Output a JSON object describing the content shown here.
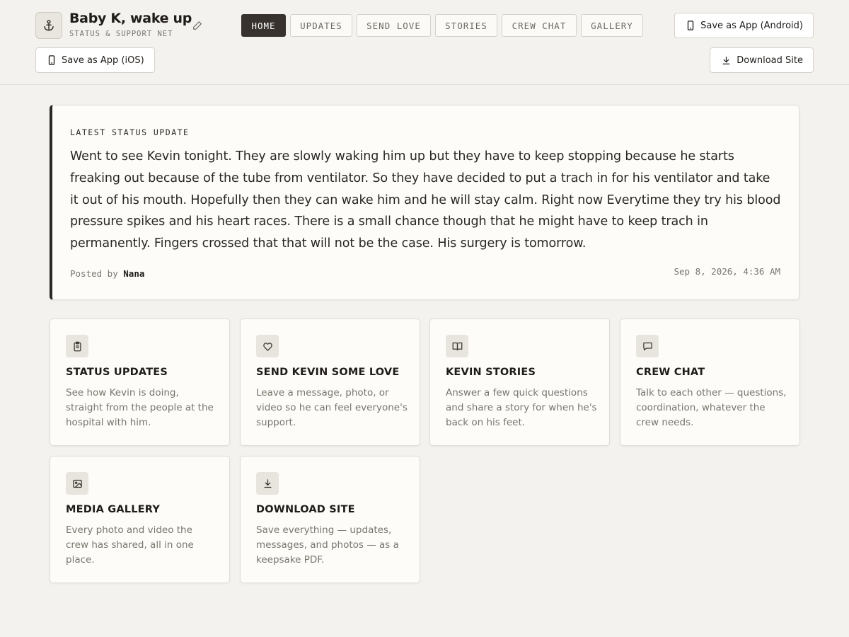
{
  "site": {
    "title": "Baby K, wake up",
    "subtitle": "STATUS & SUPPORT NET",
    "logo_icon": "anchor-icon",
    "edit_icon": "pencil-icon"
  },
  "nav": {
    "tabs": [
      {
        "label": "HOME",
        "active": true
      },
      {
        "label": "UPDATES",
        "active": false
      },
      {
        "label": "SEND LOVE",
        "active": false
      },
      {
        "label": "STORIES",
        "active": false
      },
      {
        "label": "CREW CHAT",
        "active": false
      },
      {
        "label": "GALLERY",
        "active": false
      }
    ]
  },
  "actions": {
    "android_label": "Save as App (Android)",
    "ios_label": "Save as App (iOS)",
    "download_label": "Download Site"
  },
  "status": {
    "label": "LATEST STATUS UPDATE",
    "body": "Went to see Kevin tonight. They are slowly waking him up but they have to keep stopping because he starts freaking out because of the tube from ventilator. So they have decided to put a trach in for his ventilator and take it out of his mouth. Hopefully then they can wake him and he will stay calm. Right now Everytime they try his blood pressure spikes and his heart races. There is a small chance though that he might have to keep trach in permanently. Fingers crossed that that will not be the case. His surgery is tomorrow.",
    "posted_prefix": "Posted by",
    "author": "Nana",
    "timestamp": "Sep 8, 2026, 4:36 AM"
  },
  "cards": [
    {
      "icon": "clipboard-icon",
      "title": "STATUS UPDATES",
      "desc": "See how Kevin is doing, straight from the people at the hospital with him."
    },
    {
      "icon": "heart-icon",
      "title": "SEND KEVIN SOME LOVE",
      "desc": "Leave a message, photo, or video so he can feel everyone's support."
    },
    {
      "icon": "book-icon",
      "title": "KEVIN STORIES",
      "desc": "Answer a few quick questions and share a story for when he's back on his feet."
    },
    {
      "icon": "chat-bubble-icon",
      "title": "CREW CHAT",
      "desc": "Talk to each other — questions, coordination, whatever the crew needs."
    },
    {
      "icon": "image-icon",
      "title": "MEDIA GALLERY",
      "desc": "Every photo and video the crew has shared, all in one place."
    },
    {
      "icon": "download-icon",
      "title": "DOWNLOAD SITE",
      "desc": "Save everything — updates, messages, and photos — as a keepsake PDF."
    }
  ],
  "colors": {
    "background": "#f3f2ee",
    "active_tab": "#37322d",
    "accent_border": "#2c2824",
    "muted_text": "#7a756d"
  }
}
